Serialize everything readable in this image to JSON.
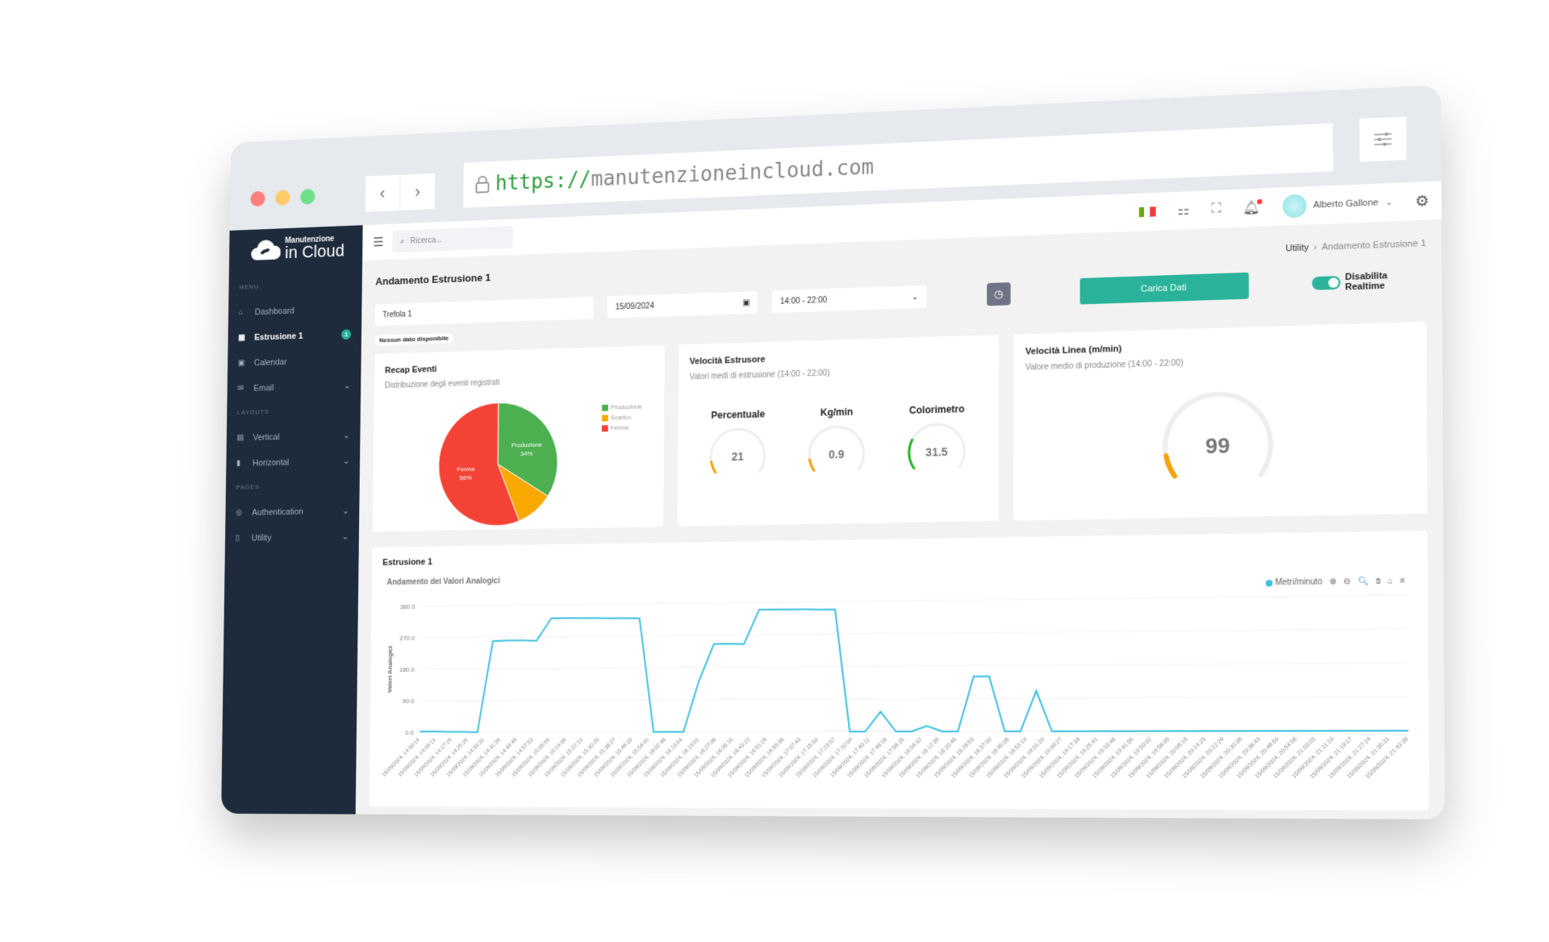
{
  "browser": {
    "url_protocol": "https://",
    "url_host": "manutenzioneincloud.com",
    "back_icon": "‹",
    "forward_icon": "›"
  },
  "sidebar": {
    "logo_line1": "Manutenzione",
    "logo_line2": "in Cloud",
    "sections": [
      {
        "title": "MENU",
        "items": [
          {
            "label": "Dashboard",
            "icon": "⌂"
          },
          {
            "label": "Estrusione 1",
            "icon": "▦",
            "badge": "1",
            "active": true
          },
          {
            "label": "Calendar",
            "icon": "▣"
          },
          {
            "label": "Email",
            "icon": "✉",
            "chevron": "⌄"
          }
        ]
      },
      {
        "title": "LAYOUTS",
        "items": [
          {
            "label": "Vertical",
            "icon": "▤",
            "chevron": "⌄"
          },
          {
            "label": "Horizontal",
            "icon": "▮",
            "chevron": "⌄"
          }
        ]
      },
      {
        "title": "PAGES",
        "items": [
          {
            "label": "Authentication",
            "icon": "◎",
            "chevron": "⌄"
          },
          {
            "label": "Utility",
            "icon": "▯",
            "chevron": "⌄"
          }
        ]
      }
    ]
  },
  "topbar": {
    "search_placeholder": "Ricerca...",
    "user_name": "Alberto Gallone",
    "flag_colors": [
      "#6aa515",
      "#ffffff",
      "#ef3b3b"
    ]
  },
  "page": {
    "title": "Andamento Estrusione 1",
    "breadcrumb": [
      "Utility",
      "Andamento Estrusione 1"
    ],
    "filters": {
      "line": "Trefola 1",
      "date": "15/09/2024",
      "shift": "14:00 - 22:00",
      "load_button": "Carica Dati",
      "realtime_label": "Disabilita Realtime",
      "realtime_on": true
    },
    "no_data": "Nessun dato disponibile"
  },
  "recap": {
    "title": "Recap Eventi",
    "subtitle": "Distribuzione degli eventi registrati"
  },
  "extruder": {
    "title": "Velocità Estrusore",
    "subtitle": "Valori medi di estrusione (14:00 - 22:00)",
    "gauges": [
      {
        "label": "Percentuale",
        "value": "21",
        "fraction": 0.1,
        "color": "#f5a30b"
      },
      {
        "label": "Kg/min",
        "value": "0.9",
        "fraction": 0.1,
        "color": "#f5a30b"
      },
      {
        "label": "Colorimetro",
        "value": "31.5",
        "fraction": 0.25,
        "color": "#1fb51f"
      }
    ]
  },
  "line_speed": {
    "title": "Velocità Linea (m/min)",
    "subtitle": "Valore medio di produzione (14:00 - 22:00)",
    "value": "99",
    "fraction": 0.1,
    "color": "#f5a30b"
  },
  "trend": {
    "card_title": "Estrusione 1"
  },
  "chart_data": [
    {
      "type": "pie",
      "title": "Recap Eventi",
      "labels": [
        "Produzione",
        "Scarico",
        "Ferma"
      ],
      "values": [
        34,
        10,
        56
      ],
      "colors": [
        "#4caf50",
        "#f9a800",
        "#f44336"
      ],
      "legend": "right"
    },
    {
      "type": "line",
      "title": "Andamento dei Valori Analogici",
      "ylabel": "Valori Analogici",
      "ylim": [
        0,
        360
      ],
      "yticks": [
        "0.0",
        "90.0",
        "180.0",
        "270.0",
        "360.0"
      ],
      "series": [
        {
          "name": "Metri/minuto",
          "color": "#3bbfe0",
          "values": [
            2,
            2,
            1,
            1,
            0,
            258,
            260,
            260,
            258,
            322,
            322,
            321,
            321,
            320,
            320,
            319,
            0,
            0,
            0,
            140,
            245,
            245,
            244,
            340,
            340,
            339,
            339,
            338,
            338,
            0,
            0,
            55,
            0,
            0,
            15,
            0,
            0,
            150,
            150,
            0,
            0,
            110,
            0,
            0,
            0,
            0,
            0,
            0,
            0,
            0,
            0,
            0,
            0,
            0,
            0,
            0,
            0,
            0,
            0,
            0,
            0,
            0,
            0,
            0,
            0
          ]
        }
      ],
      "x": [
        "15/09/2024, 14:00:14",
        "15/09/2024, 14:09:13",
        "15/09/2024, 14:17:19",
        "15/09/2024, 14:25:25",
        "15/09/2024, 14:33:32",
        "15/09/2024, 14:41:39",
        "15/09/2024, 14:49:46",
        "15/09/2024, 14:57:53",
        "15/09/2024, 15:05:59",
        "15/09/2024, 15:14:06",
        "15/09/2024, 15:22:13",
        "15/09/2024, 15:30:20",
        "15/09/2024, 15:38:27",
        "15/09/2024, 15:46:33",
        "15/09/2024, 15:54:41",
        "15/09/2024, 16:02:48",
        "15/09/2024, 16:10:54",
        "15/09/2024, 16:19:01",
        "15/09/2024, 16:27:08",
        "15/09/2024, 16:35:15",
        "15/09/2024, 16:43:22",
        "15/09/2024, 16:51:29",
        "15/09/2024, 16:59:36",
        "15/09/2024, 17:07:43",
        "15/09/2024, 17:15:50",
        "15/09/2024, 17:23:57",
        "15/09/2024, 17:32:04",
        "15/09/2024, 17:40:11",
        "15/09/2024, 17:48:18",
        "15/09/2024, 17:56:25",
        "15/09/2024, 18:04:32",
        "15/09/2024, 18:12:39",
        "15/09/2024, 18:20:46",
        "15/09/2024, 18:28:53",
        "15/09/2024, 18:37:00",
        "15/09/2024, 18:45:06",
        "15/09/2024, 18:53:13",
        "15/09/2024, 19:01:20",
        "15/09/2024, 19:09:27",
        "15/09/2024, 19:17:34",
        "15/09/2024, 19:25:41",
        "15/09/2024, 19:33:48",
        "15/09/2024, 19:41:55",
        "15/09/2024, 19:50:02",
        "15/09/2024, 19:58:09",
        "15/09/2024, 20:06:16",
        "15/09/2024, 20:14:23",
        "15/09/2024, 20:22:29",
        "15/09/2024, 20:30:36",
        "15/09/2024, 20:38:43",
        "15/09/2024, 20:46:50",
        "15/09/2024, 20:54:56",
        "15/09/2024, 21:03:03",
        "15/09/2024, 21:11:10",
        "15/09/2024, 21:19:17",
        "15/09/2024, 21:27:24",
        "15/09/2024, 21:35:31",
        "15/09/2024, 21:43:38"
      ],
      "legend": "top-right",
      "toolbar": [
        "zoom-in",
        "zoom-out",
        "selection-zoom",
        "pan",
        "reset",
        "menu"
      ]
    }
  ]
}
